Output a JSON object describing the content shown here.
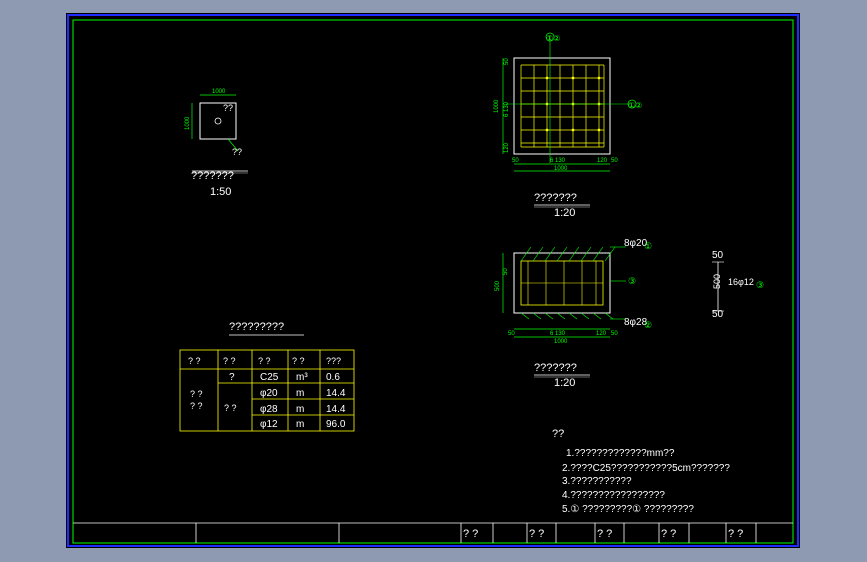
{
  "colors": {
    "background": "#8d9ab2",
    "sheet": "#000000",
    "border": "#1e2cff",
    "frame_line": "#00ff00",
    "rebar": "#ffff00",
    "text": "#ffffff",
    "dim": "#00ff00",
    "callout": "#00ff00",
    "table_line": "#ffff00"
  },
  "plan_small": {
    "dim_top": "1000",
    "dim_left": "1000",
    "label": "??",
    "leader_label": "??",
    "title": "???????",
    "scale": "1:50"
  },
  "plan_rebar": {
    "callout_top": "①②",
    "callout_right": "①②",
    "dim_left_total": "1000",
    "dim_left_mid": "6 130",
    "dim_left_top": "50",
    "dim_left_bot": "120",
    "dim_bottom_mid": "6 130",
    "dim_bottom_left": "50",
    "dim_bottom_r1": "120",
    "dim_bottom_r2": "50",
    "dim_bottom_total": "1000",
    "title": "???????",
    "scale": "1:20"
  },
  "section": {
    "label_top_bar": "8φ20",
    "label_top_num": "①",
    "label_right_num": "③",
    "label_bottom_bar": "8φ28",
    "label_bottom_num": "②",
    "dim_left": "500",
    "dim_left_small": "50",
    "dim_bottom_mid": "6 130",
    "dim_bottom_left": "50",
    "dim_bottom_r1": "120",
    "dim_bottom_r2": "50",
    "dim_bottom_total": "1000",
    "title": "???????",
    "scale": "1:20"
  },
  "stirrup": {
    "top": "50",
    "mid": "500",
    "bottom": "50",
    "label": "16φ12",
    "num": "③"
  },
  "table": {
    "title": "?????????",
    "header": [
      "? ?",
      "? ?",
      "? ?",
      "? ?",
      "???"
    ],
    "group_a": "? ?\n? ?",
    "group_b": "? ?",
    "rows": [
      [
        "?",
        "C25",
        "m³",
        "0.6"
      ],
      [
        "",
        "φ20",
        "m",
        "14.4"
      ],
      [
        "",
        "φ28",
        "m",
        "14.4"
      ],
      [
        "",
        "φ12",
        "m",
        "96.0"
      ]
    ]
  },
  "notes": {
    "heading": "??",
    "lines": [
      "1.?????????????mm??",
      "2.????C25???????????5cm???????",
      "3.???????????",
      "4.?????????????????",
      "5.① ?????????① ?????????"
    ]
  },
  "title_block": {
    "cells": [
      "? ?",
      "? ?",
      "? ?",
      "? ?",
      "? ?"
    ]
  }
}
